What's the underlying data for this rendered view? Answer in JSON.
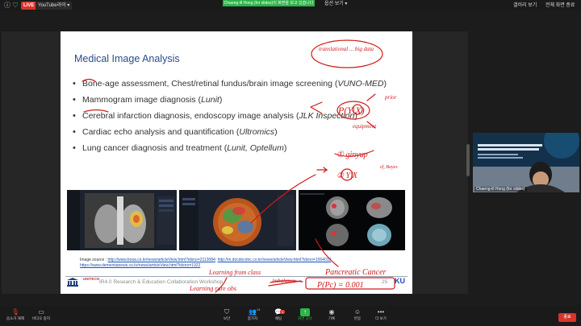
{
  "topbar": {
    "live_label": "LIVE",
    "live_destination": "YouTube라이 ▾",
    "notice": "Chaeng-ill Hong (for slides)이 화면을 보고 있습니다",
    "stop_share_label": "옵션 보기 ▾",
    "gallery_label": "갤러리 보기",
    "fullscreen_label": "전체 화면 종료"
  },
  "slide": {
    "title": "Medical Image Analysis",
    "bullets": [
      {
        "text": "Bone-age assessment, Chest/retinal fundus/brain image screening (",
        "em": "VUNO-MED",
        "tail": ")"
      },
      {
        "text": "Mammogram image diagnosis (",
        "em": "Lunit",
        "tail": ")"
      },
      {
        "text": "Cerebral infarction diagnosis, endoscopy image analysis (",
        "em": "JLK Inspection",
        "tail": ")"
      },
      {
        "text": "Cardiac echo analysis and quantification (",
        "em": "Ultromics",
        "tail": ")"
      },
      {
        "text": "Lung cancer diagnosis and treatment (",
        "em": "Lunit, Optellum",
        "tail": ")"
      }
    ],
    "source_label": "Image source : ",
    "source_links": [
      "http://www.bosa.co.kr/news/articleView.html?idxno=2113084",
      "http://m.docdocdoc.co.kr/news/articleView.html?idxno=1064013",
      "https://www.dementianews.co.kr/news/articleView.html?idxno=1922"
    ],
    "footer_text": "IR4.0 Research & Education Collaboration Workshop",
    "page_number": "25",
    "unitech_logo": "UNITECH"
  },
  "annotations": {
    "top_right": "translational ... big data",
    "formula": "P(Y|X)",
    "formula_note_1": "prior",
    "formula_note_2": "equipment",
    "item1": "① ginyup",
    "item2": "② Y|X",
    "item2_note": "ef, Bayes",
    "pancreatic": "Pancreatic Cancer",
    "imbalance": "imbalance",
    "learning1": "Learning from class",
    "learning2": "Learning rare obs",
    "prob": "P(Pc) = 0.001"
  },
  "participant": {
    "name": "Chaeng-ill Hong (for slides)",
    "slide_title": "Industry 4.0 Research & Education Collaboration Workshop"
  },
  "toolbar": {
    "items": [
      {
        "label": "음소거 해제",
        "icon": "mic-muted-icon"
      },
      {
        "label": "비디오 중지",
        "icon": "video-icon"
      },
      {
        "label": "보안",
        "icon": "shield-icon"
      },
      {
        "label": "참가자",
        "icon": "participants-icon",
        "count": "14"
      },
      {
        "label": "채팅",
        "icon": "chat-icon",
        "badge": "1"
      },
      {
        "label": "화면 공유",
        "icon": "share-screen-icon"
      },
      {
        "label": "기록",
        "icon": "record-icon"
      },
      {
        "label": "반응",
        "icon": "reaction-icon"
      },
      {
        "label": "더 보기",
        "icon": "more-icon"
      }
    ],
    "end_label": "종료"
  },
  "colors": {
    "title_blue": "#2c4a8c",
    "annotation_red": "#d11a1a",
    "share_green": "#2fb34a",
    "end_red": "#d9342b"
  }
}
